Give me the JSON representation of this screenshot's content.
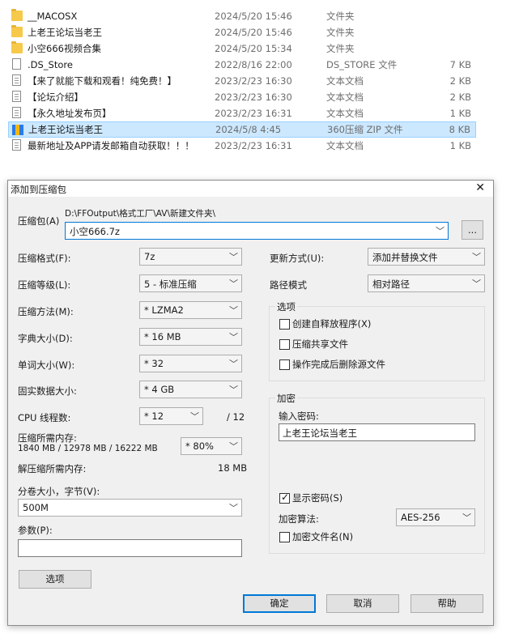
{
  "files": [
    {
      "name": "__MACOSX",
      "date": "2024/5/20 15:46",
      "type": "文件夹",
      "size": "",
      "icon": "folder-icon"
    },
    {
      "name": "上老王论坛当老王",
      "date": "2024/5/20 15:46",
      "type": "文件夹",
      "size": "",
      "icon": "folder-icon"
    },
    {
      "name": "小空666视频合集",
      "date": "2024/5/20 15:34",
      "type": "文件夹",
      "size": "",
      "icon": "folder-icon"
    },
    {
      "name": ".DS_Store",
      "date": "2022/8/16 22:00",
      "type": "DS_STORE 文件",
      "size": "7 KB",
      "icon": "file-icon"
    },
    {
      "name": "【来了就能下载和观看！纯免费！】",
      "date": "2023/2/23 16:30",
      "type": "文本文档",
      "size": "2 KB",
      "icon": "text-document-icon"
    },
    {
      "name": "【论坛介绍】",
      "date": "2023/2/23 16:30",
      "type": "文本文档",
      "size": "2 KB",
      "icon": "text-document-icon"
    },
    {
      "name": "【永久地址发布页】",
      "date": "2023/2/23 16:31",
      "type": "文本文档",
      "size": "1 KB",
      "icon": "text-document-icon"
    },
    {
      "name": "上老王论坛当老王",
      "date": "2024/5/8 4:45",
      "type": "360压缩 ZIP 文件",
      "size": "8 KB",
      "icon": "zip-archive-icon"
    },
    {
      "name": "最新地址及APP请发邮箱自动获取！！！",
      "date": "2023/2/23 16:31",
      "type": "文本文档",
      "size": "1 KB",
      "icon": "text-document-icon"
    }
  ],
  "dialog": {
    "title": "添加到压缩包",
    "close": "✕",
    "archive_label": "压缩包(A)",
    "archive_path": "D:\\FFOutput\\格式工厂\\AV\\新建文件夹\\",
    "archive_name": "小空666.7z",
    "browse": "...",
    "format_label": "压缩格式(F):",
    "format_value": "7z",
    "level_label": "压缩等级(L):",
    "level_value": "5 - 标准压缩",
    "method_label": "压缩方法(M):",
    "method_value": "* LZMA2",
    "dict_label": "字典大小(D):",
    "dict_value": "* 16 MB",
    "word_label": "单词大小(W):",
    "word_value": "* 32",
    "solid_label": "固实数据大小:",
    "solid_value": "* 4 GB",
    "cpu_label": "CPU 线程数:",
    "cpu_value": "* 12",
    "cpu_total": "/ 12",
    "mem_label": "压缩所需内存:",
    "mem_detail": "1840 MB / 12978 MB / 16222 MB",
    "mem_value": "* 80%",
    "decomp_label": "解压缩所需内存:",
    "decomp_value": "18 MB",
    "split_label": "分卷大小，字节(V):",
    "split_value": "500M",
    "params_label": "参数(P):",
    "params_value": "",
    "options_button": "选项",
    "update_label": "更新方式(U):",
    "update_value": "添加并替换文件",
    "pathmode_label": "路径模式",
    "pathmode_value": "相对路径",
    "options_group": "选项",
    "opt_sfx": "创建自释放程序(X)",
    "opt_shared": "压缩共享文件",
    "opt_delete": "操作完成后删除源文件",
    "encrypt_group": "加密",
    "password_label": "输入密码:",
    "password_value": "上老王论坛当老王",
    "show_password": "显示密码(S)",
    "enc_method_label": "加密算法:",
    "enc_method_value": "AES-256",
    "encrypt_names": "加密文件名(N)",
    "ok": "确定",
    "cancel": "取消",
    "help": "帮助"
  }
}
